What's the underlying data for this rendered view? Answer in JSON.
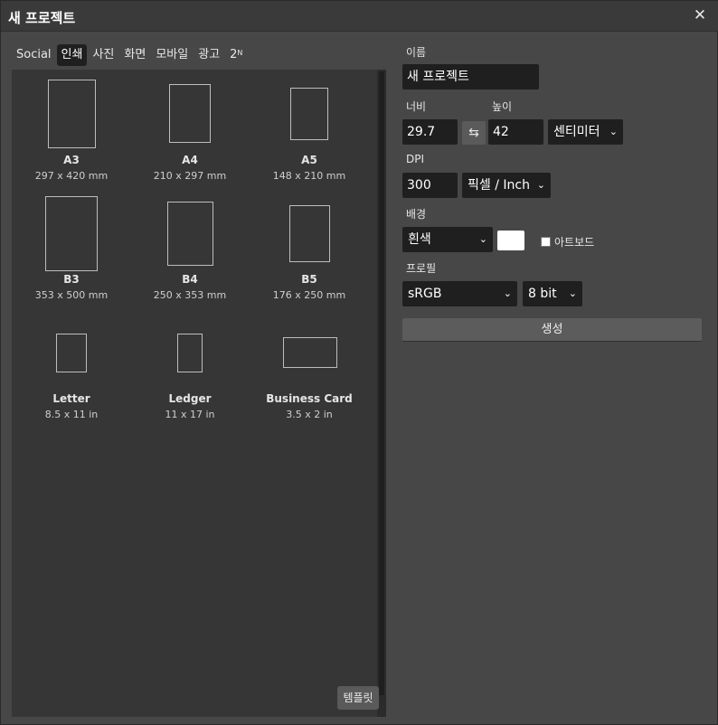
{
  "dialog": {
    "title": "새 프로젝트",
    "close_glyph": "✕"
  },
  "tabs": [
    {
      "label": "Social",
      "active": false
    },
    {
      "label": "인쇄",
      "active": true
    },
    {
      "label": "사진",
      "active": false
    },
    {
      "label": "화면",
      "active": false
    },
    {
      "label": "모바일",
      "active": false
    },
    {
      "label": "광고",
      "active": false
    },
    {
      "label": "2",
      "sup": "N",
      "active": false
    }
  ],
  "presets": [
    {
      "name": "A3",
      "size": "297 x 420 mm"
    },
    {
      "name": "A4",
      "size": "210 x 297 mm"
    },
    {
      "name": "A5",
      "size": "148 x 210 mm"
    },
    {
      "name": "B3",
      "size": "353 x 500 mm"
    },
    {
      "name": "B4",
      "size": "250 x 353 mm"
    },
    {
      "name": "B5",
      "size": "176 x 250 mm"
    },
    {
      "name": "Letter",
      "size": "8.5 x 11 in"
    },
    {
      "name": "Ledger",
      "size": "11 x 17 in"
    },
    {
      "name": "Business Card",
      "size": "3.5 x 2 in"
    }
  ],
  "template_button": "템플릿",
  "form": {
    "name_label": "이름",
    "name_value": "새 프로젝트",
    "width_label": "너비",
    "width_value": "29.7",
    "height_label": "높이",
    "height_value": "42",
    "swap_glyph": "⇆",
    "unit": "센티미터",
    "dpi_label": "DPI",
    "dpi_value": "300",
    "dpi_unit": "픽셀 / Inch",
    "background_label": "배경",
    "background_value": "흰색",
    "background_color": "#ffffff",
    "artboard_label": "아트보드",
    "artboard_checked": false,
    "profile_label": "프로필",
    "profile_value": "sRGB",
    "bitdepth_value": "8 bit",
    "chevron_glyph": "⌄",
    "create_label": "생성"
  }
}
